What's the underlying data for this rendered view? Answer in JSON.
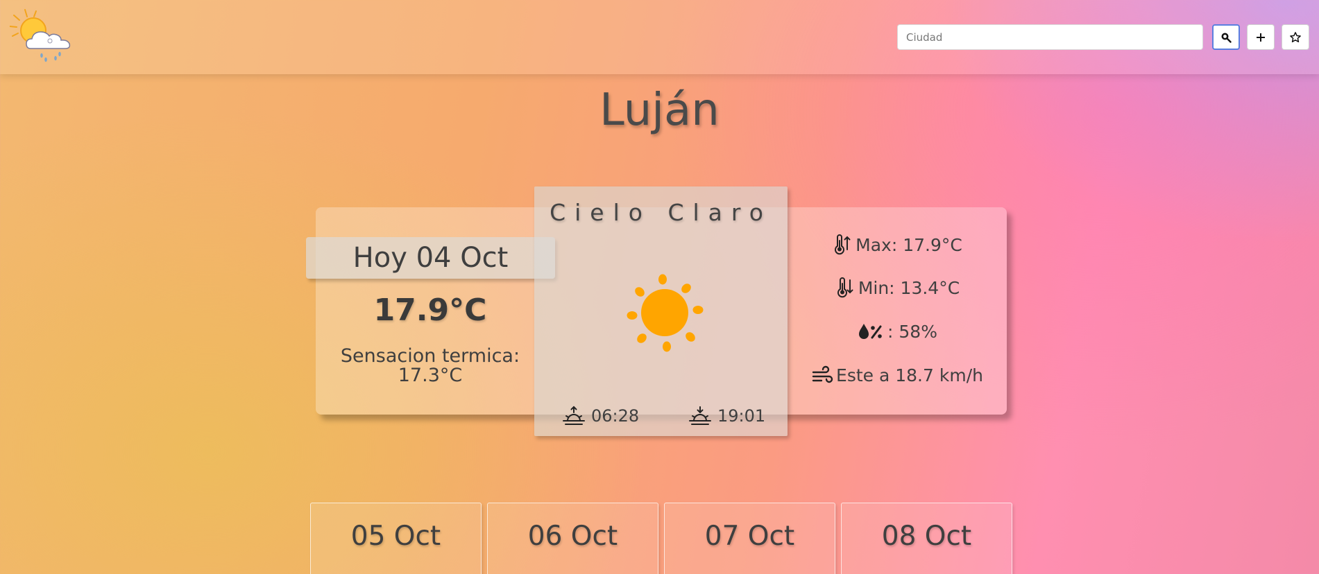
{
  "header": {
    "logo_icon": "sun-cloud-rain-icon",
    "search": {
      "placeholder": "Ciudad",
      "value": ""
    },
    "buttons": [
      {
        "icon": "search-icon"
      },
      {
        "icon": "plus-icon"
      },
      {
        "icon": "star-icon"
      }
    ]
  },
  "city": "Luján",
  "today": {
    "date": "Hoy 04 Oct",
    "temperature": "17.9°C",
    "feels_like_label": "Sensacion termica:",
    "feels_like_value": "17.3°C",
    "condition": "Cielo Claro",
    "condition_icon": "sun-icon",
    "sunrise": "06:28",
    "sunset": "19:01",
    "max": "Max: 17.9°C",
    "min": "Min: 13.4°C",
    "humidity": ": 58%",
    "wind": "Este a 18.7 km/h"
  },
  "forecast": [
    {
      "date": "05 Oct"
    },
    {
      "date": "06 Oct"
    },
    {
      "date": "07 Oct"
    },
    {
      "date": "08 Oct"
    }
  ],
  "colors": {
    "sun": "#ffa500",
    "text": "#3f3f3f"
  }
}
